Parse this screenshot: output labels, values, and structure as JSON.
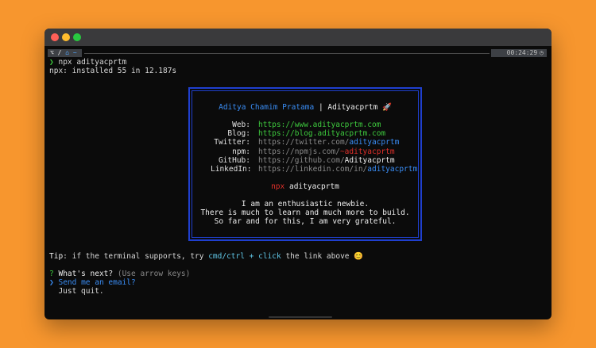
{
  "colors": {
    "background": "#f7962e",
    "terminal_bg": "#0b0b0b",
    "accent_blue": "#3a8df5",
    "accent_green": "#3ecb3e",
    "accent_red": "#e0302a",
    "border_blue": "#1f3fcf"
  },
  "window": {
    "controls": [
      "close",
      "minimize",
      "zoom"
    ]
  },
  "prompt_bar": {
    "segment1": "⌥ /",
    "segment2": "⌂ ~",
    "time": "00:24:29",
    "time_icon": "clock-icon"
  },
  "command": {
    "prompt_char": "❯",
    "text": "npx adityacprtm"
  },
  "install_msg": "npx: installed 55 in 12.187s",
  "card": {
    "name": "Aditya Chamim Pratama",
    "separator": "|",
    "handle": "Adityacprtm",
    "emoji": "🚀",
    "links": [
      {
        "label": "Web:",
        "prefix": "https://www.adityacprtm.com",
        "suffix": ""
      },
      {
        "label": "Blog:",
        "prefix": "https://blog.adityacprtm.com",
        "suffix": ""
      },
      {
        "label": "Twitter:",
        "prefix": "https://twitter.com/",
        "suffix": "adityacprtm"
      },
      {
        "label": "npm:",
        "prefix": "https://npmjs.com/",
        "suffix": "~adityacprtm"
      },
      {
        "label": "GitHub:",
        "prefix": "https://github.com/",
        "suffix": "Adityacprtm"
      },
      {
        "label": "LinkedIn:",
        "prefix": "https://linkedin.com/in/",
        "suffix": "adityacprtm"
      }
    ],
    "npx_word": "npx",
    "npx_pkg": "adityacprtm",
    "bio": [
      "I am an enthusiastic newbie.",
      "There is much to learn and much more to build.",
      "So far and for this, I am very grateful."
    ]
  },
  "tip": {
    "label": "Tip",
    "text1": ": if the terminal supports, try ",
    "keys": "cmd/ctrl + click",
    "text2": " the link above ",
    "emoji": "😊"
  },
  "menu": {
    "question_mark": "?",
    "question": "What's next?",
    "hint": "(Use arrow keys)",
    "pointer": "❯",
    "options": [
      "Send me an email?",
      "Just quit."
    ]
  }
}
